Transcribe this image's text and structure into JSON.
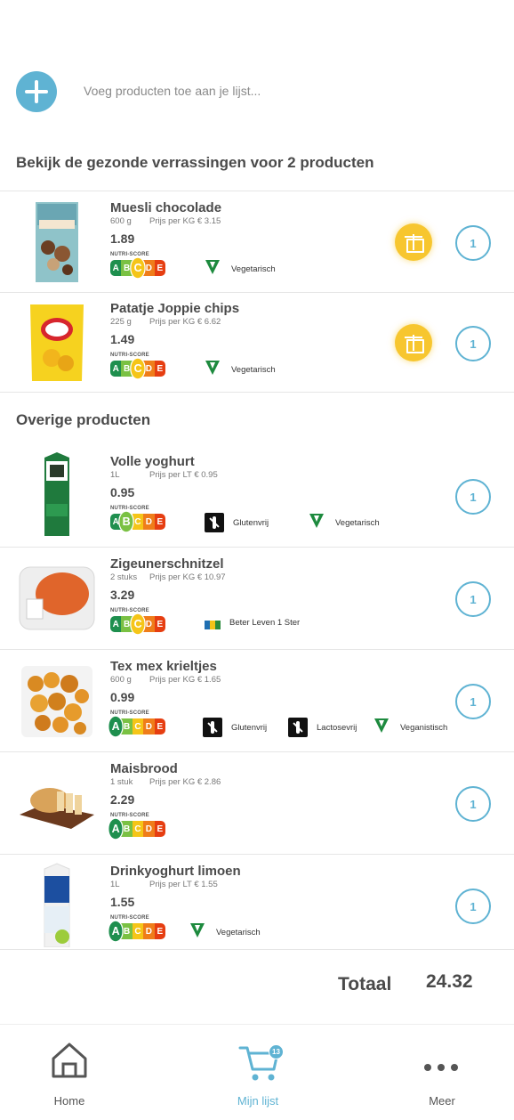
{
  "add_bar": {
    "placeholder": "Voeg producten toe aan je lijst..."
  },
  "sections": {
    "surprises_title": "Bekijk de gezonde verrassingen voor 2 producten",
    "other_title": "Overige producten"
  },
  "nutri_label": "NUTRI-SCORE",
  "nutri_letters": [
    "A",
    "B",
    "C",
    "D",
    "E"
  ],
  "surprise_products": [
    {
      "name": "Muesli chocolade",
      "qty": "600 g",
      "unit_price": "Prijs per KG € 3.15",
      "price": "1.89",
      "nutri": "C",
      "tags": [
        {
          "icon": "vega-icon",
          "label": "Vegetarisch"
        }
      ],
      "count": "1"
    },
    {
      "name": "Patatje Joppie chips",
      "qty": "225 g",
      "unit_price": "Prijs per KG € 6.62",
      "price": "1.49",
      "nutri": "C",
      "tags": [
        {
          "icon": "vega-icon",
          "label": "Vegetarisch"
        }
      ],
      "count": "1"
    }
  ],
  "other_products": [
    {
      "name": "Volle yoghurt",
      "qty": "1L",
      "unit_price": "Prijs per LT € 0.95",
      "price": "0.95",
      "nutri": "B",
      "tags": [
        {
          "icon": "gluten-free-icon",
          "label": "Glutenvrij"
        },
        {
          "icon": "vega-icon",
          "label": "Vegetarisch"
        }
      ],
      "count": "1"
    },
    {
      "name": "Zigeunerschnitzel",
      "qty": "2 stuks",
      "unit_price": "Prijs per KG € 10.97",
      "price": "3.29",
      "nutri": "C",
      "tags": [
        {
          "icon": "beter-leven-icon",
          "label": "Beter Leven 1 Ster"
        }
      ],
      "count": "1"
    },
    {
      "name": "Tex mex krieltjes",
      "qty": "600 g",
      "unit_price": "Prijs per KG € 1.65",
      "price": "0.99",
      "nutri": "A",
      "tags": [
        {
          "icon": "gluten-free-icon",
          "label": "Glutenvrij"
        },
        {
          "icon": "lactose-free-icon",
          "label": "Lactosevrij"
        },
        {
          "icon": "vegan-icon",
          "label": "Veganistisch"
        }
      ],
      "count": "1"
    },
    {
      "name": "Maisbrood",
      "qty": "1 stuk",
      "unit_price": "Prijs per KG € 2.86",
      "price": "2.29",
      "nutri": "A",
      "tags": [],
      "count": "1"
    },
    {
      "name": "Drinkyoghurt limoen",
      "qty": "1L",
      "unit_price": "Prijs per LT € 1.55",
      "price": "1.55",
      "nutri": "A",
      "tags": [
        {
          "icon": "vega-icon",
          "label": "Vegetarisch"
        }
      ],
      "count": "1"
    }
  ],
  "total": {
    "label": "Totaal",
    "value": "24.32"
  },
  "tabbar": {
    "home": "Home",
    "list": "Mijn lijst",
    "list_badge": "13",
    "more": "Meer"
  },
  "colors": {
    "accent": "#5fb3d3",
    "gift": "#f7c62f"
  }
}
